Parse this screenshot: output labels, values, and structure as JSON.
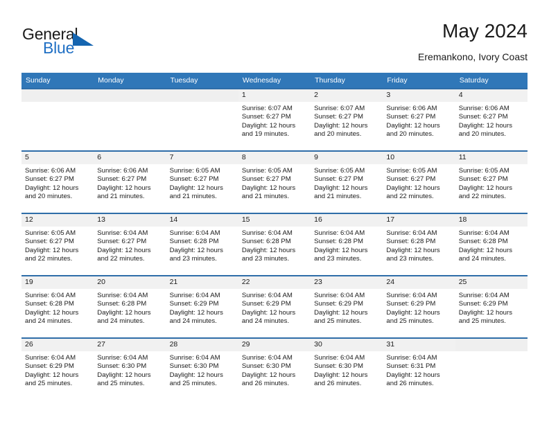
{
  "brand": {
    "word_one": "General",
    "word_two": "Blue",
    "triangle_icon": "brand-triangle-icon",
    "accent_color": "#1565b0"
  },
  "header": {
    "title": "May 2024",
    "subtitle": "Eremankono, Ivory Coast"
  },
  "theme": {
    "header_row_bg": "#3077b8",
    "row_divider": "#2e6da8",
    "daynum_band_bg": "#f1f1f1",
    "text": "#1a1a1a"
  },
  "weekday_headers": [
    "Sunday",
    "Monday",
    "Tuesday",
    "Wednesday",
    "Thursday",
    "Friday",
    "Saturday"
  ],
  "weeks": [
    [
      {
        "day": "",
        "sunrise": "",
        "sunset": "",
        "daylight_line1": "",
        "daylight_line2": ""
      },
      {
        "day": "",
        "sunrise": "",
        "sunset": "",
        "daylight_line1": "",
        "daylight_line2": ""
      },
      {
        "day": "",
        "sunrise": "",
        "sunset": "",
        "daylight_line1": "",
        "daylight_line2": ""
      },
      {
        "day": "1",
        "sunrise": "Sunrise: 6:07 AM",
        "sunset": "Sunset: 6:27 PM",
        "daylight_line1": "Daylight: 12 hours",
        "daylight_line2": "and 19 minutes."
      },
      {
        "day": "2",
        "sunrise": "Sunrise: 6:07 AM",
        "sunset": "Sunset: 6:27 PM",
        "daylight_line1": "Daylight: 12 hours",
        "daylight_line2": "and 20 minutes."
      },
      {
        "day": "3",
        "sunrise": "Sunrise: 6:06 AM",
        "sunset": "Sunset: 6:27 PM",
        "daylight_line1": "Daylight: 12 hours",
        "daylight_line2": "and 20 minutes."
      },
      {
        "day": "4",
        "sunrise": "Sunrise: 6:06 AM",
        "sunset": "Sunset: 6:27 PM",
        "daylight_line1": "Daylight: 12 hours",
        "daylight_line2": "and 20 minutes."
      }
    ],
    [
      {
        "day": "5",
        "sunrise": "Sunrise: 6:06 AM",
        "sunset": "Sunset: 6:27 PM",
        "daylight_line1": "Daylight: 12 hours",
        "daylight_line2": "and 20 minutes."
      },
      {
        "day": "6",
        "sunrise": "Sunrise: 6:06 AM",
        "sunset": "Sunset: 6:27 PM",
        "daylight_line1": "Daylight: 12 hours",
        "daylight_line2": "and 21 minutes."
      },
      {
        "day": "7",
        "sunrise": "Sunrise: 6:05 AM",
        "sunset": "Sunset: 6:27 PM",
        "daylight_line1": "Daylight: 12 hours",
        "daylight_line2": "and 21 minutes."
      },
      {
        "day": "8",
        "sunrise": "Sunrise: 6:05 AM",
        "sunset": "Sunset: 6:27 PM",
        "daylight_line1": "Daylight: 12 hours",
        "daylight_line2": "and 21 minutes."
      },
      {
        "day": "9",
        "sunrise": "Sunrise: 6:05 AM",
        "sunset": "Sunset: 6:27 PM",
        "daylight_line1": "Daylight: 12 hours",
        "daylight_line2": "and 21 minutes."
      },
      {
        "day": "10",
        "sunrise": "Sunrise: 6:05 AM",
        "sunset": "Sunset: 6:27 PM",
        "daylight_line1": "Daylight: 12 hours",
        "daylight_line2": "and 22 minutes."
      },
      {
        "day": "11",
        "sunrise": "Sunrise: 6:05 AM",
        "sunset": "Sunset: 6:27 PM",
        "daylight_line1": "Daylight: 12 hours",
        "daylight_line2": "and 22 minutes."
      }
    ],
    [
      {
        "day": "12",
        "sunrise": "Sunrise: 6:05 AM",
        "sunset": "Sunset: 6:27 PM",
        "daylight_line1": "Daylight: 12 hours",
        "daylight_line2": "and 22 minutes."
      },
      {
        "day": "13",
        "sunrise": "Sunrise: 6:04 AM",
        "sunset": "Sunset: 6:27 PM",
        "daylight_line1": "Daylight: 12 hours",
        "daylight_line2": "and 22 minutes."
      },
      {
        "day": "14",
        "sunrise": "Sunrise: 6:04 AM",
        "sunset": "Sunset: 6:28 PM",
        "daylight_line1": "Daylight: 12 hours",
        "daylight_line2": "and 23 minutes."
      },
      {
        "day": "15",
        "sunrise": "Sunrise: 6:04 AM",
        "sunset": "Sunset: 6:28 PM",
        "daylight_line1": "Daylight: 12 hours",
        "daylight_line2": "and 23 minutes."
      },
      {
        "day": "16",
        "sunrise": "Sunrise: 6:04 AM",
        "sunset": "Sunset: 6:28 PM",
        "daylight_line1": "Daylight: 12 hours",
        "daylight_line2": "and 23 minutes."
      },
      {
        "day": "17",
        "sunrise": "Sunrise: 6:04 AM",
        "sunset": "Sunset: 6:28 PM",
        "daylight_line1": "Daylight: 12 hours",
        "daylight_line2": "and 23 minutes."
      },
      {
        "day": "18",
        "sunrise": "Sunrise: 6:04 AM",
        "sunset": "Sunset: 6:28 PM",
        "daylight_line1": "Daylight: 12 hours",
        "daylight_line2": "and 24 minutes."
      }
    ],
    [
      {
        "day": "19",
        "sunrise": "Sunrise: 6:04 AM",
        "sunset": "Sunset: 6:28 PM",
        "daylight_line1": "Daylight: 12 hours",
        "daylight_line2": "and 24 minutes."
      },
      {
        "day": "20",
        "sunrise": "Sunrise: 6:04 AM",
        "sunset": "Sunset: 6:28 PM",
        "daylight_line1": "Daylight: 12 hours",
        "daylight_line2": "and 24 minutes."
      },
      {
        "day": "21",
        "sunrise": "Sunrise: 6:04 AM",
        "sunset": "Sunset: 6:29 PM",
        "daylight_line1": "Daylight: 12 hours",
        "daylight_line2": "and 24 minutes."
      },
      {
        "day": "22",
        "sunrise": "Sunrise: 6:04 AM",
        "sunset": "Sunset: 6:29 PM",
        "daylight_line1": "Daylight: 12 hours",
        "daylight_line2": "and 24 minutes."
      },
      {
        "day": "23",
        "sunrise": "Sunrise: 6:04 AM",
        "sunset": "Sunset: 6:29 PM",
        "daylight_line1": "Daylight: 12 hours",
        "daylight_line2": "and 25 minutes."
      },
      {
        "day": "24",
        "sunrise": "Sunrise: 6:04 AM",
        "sunset": "Sunset: 6:29 PM",
        "daylight_line1": "Daylight: 12 hours",
        "daylight_line2": "and 25 minutes."
      },
      {
        "day": "25",
        "sunrise": "Sunrise: 6:04 AM",
        "sunset": "Sunset: 6:29 PM",
        "daylight_line1": "Daylight: 12 hours",
        "daylight_line2": "and 25 minutes."
      }
    ],
    [
      {
        "day": "26",
        "sunrise": "Sunrise: 6:04 AM",
        "sunset": "Sunset: 6:29 PM",
        "daylight_line1": "Daylight: 12 hours",
        "daylight_line2": "and 25 minutes."
      },
      {
        "day": "27",
        "sunrise": "Sunrise: 6:04 AM",
        "sunset": "Sunset: 6:30 PM",
        "daylight_line1": "Daylight: 12 hours",
        "daylight_line2": "and 25 minutes."
      },
      {
        "day": "28",
        "sunrise": "Sunrise: 6:04 AM",
        "sunset": "Sunset: 6:30 PM",
        "daylight_line1": "Daylight: 12 hours",
        "daylight_line2": "and 25 minutes."
      },
      {
        "day": "29",
        "sunrise": "Sunrise: 6:04 AM",
        "sunset": "Sunset: 6:30 PM",
        "daylight_line1": "Daylight: 12 hours",
        "daylight_line2": "and 26 minutes."
      },
      {
        "day": "30",
        "sunrise": "Sunrise: 6:04 AM",
        "sunset": "Sunset: 6:30 PM",
        "daylight_line1": "Daylight: 12 hours",
        "daylight_line2": "and 26 minutes."
      },
      {
        "day": "31",
        "sunrise": "Sunrise: 6:04 AM",
        "sunset": "Sunset: 6:31 PM",
        "daylight_line1": "Daylight: 12 hours",
        "daylight_line2": "and 26 minutes."
      },
      {
        "day": "",
        "sunrise": "",
        "sunset": "",
        "daylight_line1": "",
        "daylight_line2": ""
      }
    ]
  ]
}
